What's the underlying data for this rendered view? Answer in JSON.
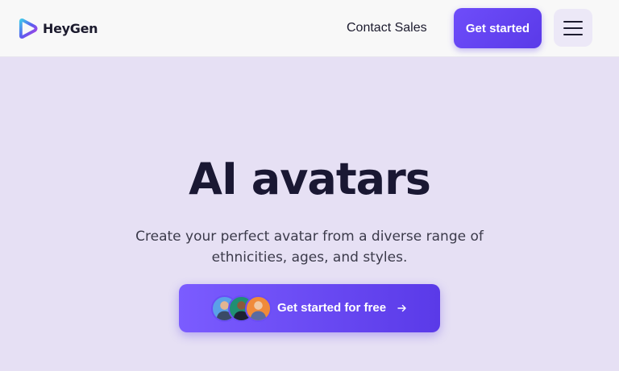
{
  "header": {
    "brand": "HeyGen",
    "contact_label": "Contact Sales",
    "get_started_label": "Get started",
    "menu_icon": "hamburger-menu-icon"
  },
  "hero": {
    "title": "AI avatars",
    "subtitle": "Create your perfect avatar from a diverse range of ethnicities, ages, and styles.",
    "cta_label": "Get started for free",
    "cta_icon": "arrow-right-icon"
  },
  "colors": {
    "accent": "#6a4af5",
    "background": "#e6e0f4",
    "header_bg": "#f8f8f8",
    "text_dark": "#1a1833"
  }
}
